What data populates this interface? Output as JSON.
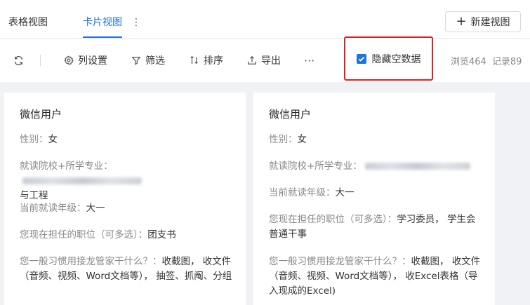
{
  "tabs": {
    "table_view": "表格视图",
    "card_view": "卡片视图",
    "more": "⋮",
    "new_view": "新建视图"
  },
  "toolbar": {
    "columns": "列设置",
    "filter": "筛选",
    "sort": "排序",
    "export": "导出",
    "more": "···",
    "hide_empty": "隐藏空数据",
    "views": "浏览464",
    "records": "记录89"
  },
  "cards": [
    {
      "title": "微信用户",
      "gender_label": "性别：",
      "gender": "女",
      "school_label": "就读院校+所学专业：",
      "school_tail": "与工程",
      "grade_label": "当前就读年级：",
      "grade": "大一",
      "position_label": "您现在担任的职位（可多选）：",
      "position": "团支书",
      "usage_label": "您一般习惯用接龙管家干什么？：",
      "usage": "收截图， 收文件（音频、视频、Word文档等）， 抽签、抓阄、分组"
    },
    {
      "title": "微信用户",
      "gender_label": "性别：",
      "gender": "女",
      "school_label": "就读院校+所学专业：",
      "grade_label": "当前就读年级：",
      "grade": "大一",
      "position_label": "您现在担任的职位（可多选）：",
      "position": "学习委员， 学生会普通干事",
      "usage_label": "您一般习惯用接龙管家干什么？：",
      "usage": "收截图， 收文件（音频、视频、Word文档等）， 收Excel表格（导入现成的Excel)"
    }
  ]
}
